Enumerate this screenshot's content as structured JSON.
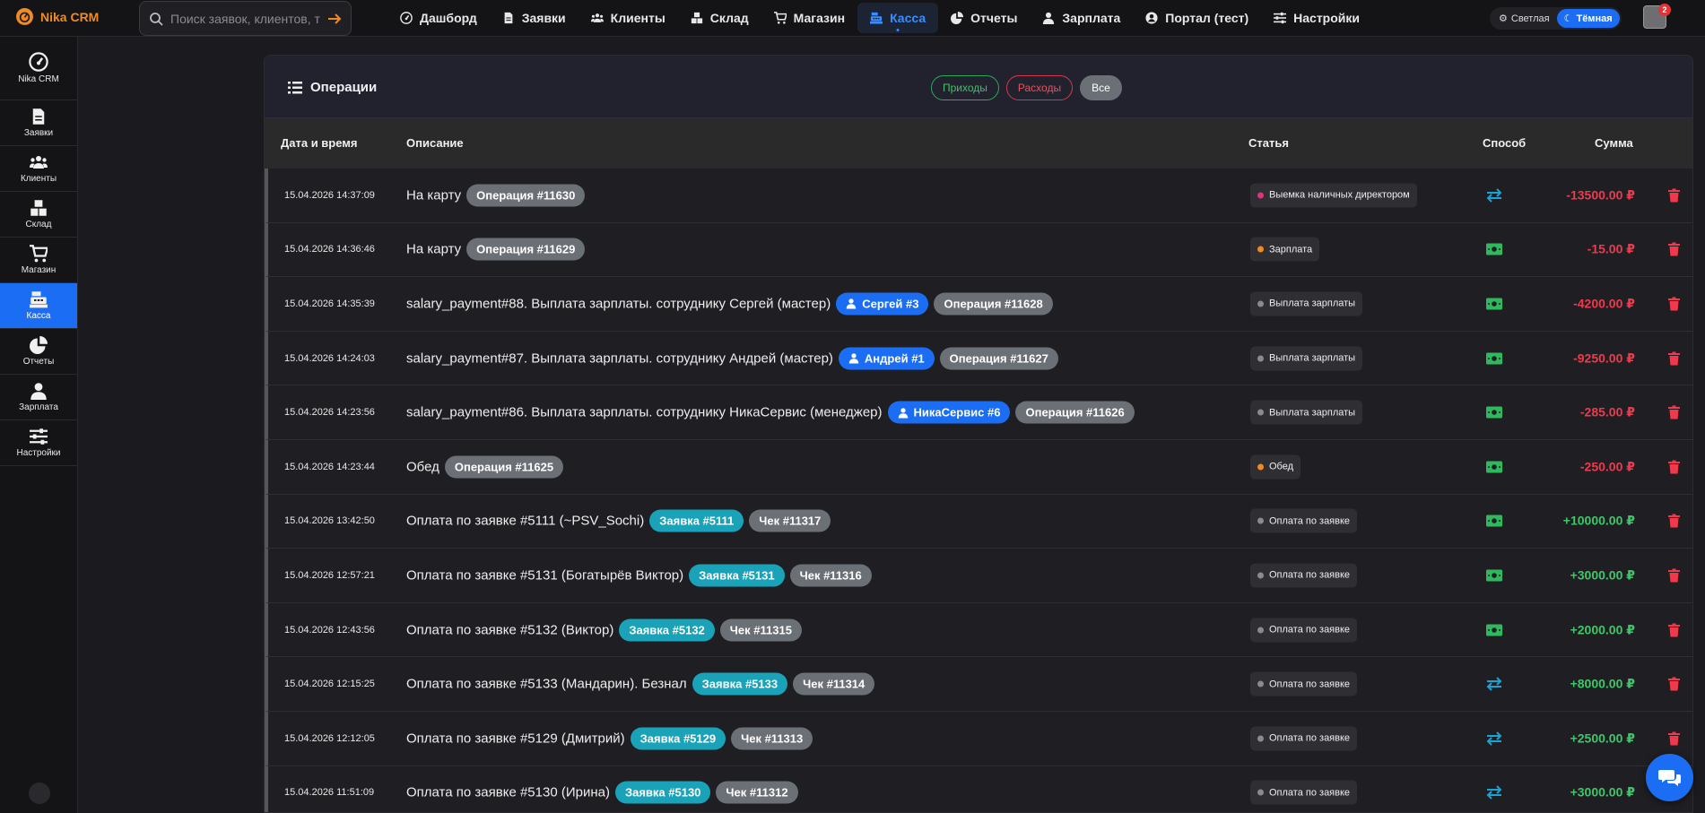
{
  "app": {
    "name": "Nika CRM"
  },
  "search": {
    "placeholder": "Поиск заявок, клиентов, т"
  },
  "nav": [
    {
      "label": "Дашборд",
      "icon": "gauge-icon"
    },
    {
      "label": "Заявки",
      "icon": "file-icon"
    },
    {
      "label": "Клиенты",
      "icon": "users-icon"
    },
    {
      "label": "Склад",
      "icon": "boxes-icon"
    },
    {
      "label": "Магазин",
      "icon": "cart-icon"
    },
    {
      "label": "Касса",
      "icon": "cash-register-icon",
      "active": true
    },
    {
      "label": "Отчеты",
      "icon": "pie-chart-icon"
    },
    {
      "label": "Зарплата",
      "icon": "user-icon"
    },
    {
      "label": "Портал (тест)",
      "icon": "user-circle-icon"
    },
    {
      "label": "Настройки",
      "icon": "sliders-icon"
    }
  ],
  "theme": {
    "light": "Светлая",
    "dark": "Тёмная"
  },
  "notifications": {
    "count": "2"
  },
  "sidebar": [
    {
      "label": "Nika CRM",
      "icon": "gauge-icon"
    },
    {
      "label": "Заявки",
      "icon": "file-icon"
    },
    {
      "label": "Клиенты",
      "icon": "users-icon"
    },
    {
      "label": "Склад",
      "icon": "boxes-icon"
    },
    {
      "label": "Магазин",
      "icon": "cart-icon"
    },
    {
      "label": "Касса",
      "icon": "cash-register-icon",
      "active": true
    },
    {
      "label": "Отчеты",
      "icon": "pie-chart-icon"
    },
    {
      "label": "Зарплата",
      "icon": "user-icon"
    },
    {
      "label": "Настройки",
      "icon": "sliders-icon"
    }
  ],
  "card": {
    "title": "Операции",
    "filters": {
      "income": "Приходы",
      "expense": "Расходы",
      "all": "Все"
    }
  },
  "table": {
    "headers": {
      "date": "Дата и время",
      "description": "Описание",
      "category": "Статья",
      "method": "Способ",
      "amount": "Сумма"
    },
    "rows": [
      {
        "date": "15.04.2026 14:37:09",
        "text": "На карту",
        "tags": [
          {
            "kind": "op",
            "label": "Операция #11630"
          }
        ],
        "category": "Выемка наличных директором",
        "cat_color": "#e0337d",
        "method": "transfer",
        "amount": "-13500.00 ₽",
        "sign": "neg"
      },
      {
        "date": "15.04.2026 14:36:46",
        "text": "На карту",
        "tags": [
          {
            "kind": "op",
            "label": "Операция #11629"
          }
        ],
        "category": "Зарплата",
        "cat_color": "#f08a24",
        "method": "cash",
        "amount": "-15.00 ₽",
        "sign": "neg"
      },
      {
        "date": "15.04.2026 14:35:39",
        "text": "salary_payment#88. Выплата зарплаты. сотруднику Сергей (мастер)",
        "tags": [
          {
            "kind": "user",
            "label": "Сергей #3"
          },
          {
            "kind": "op",
            "label": "Операция #11628"
          }
        ],
        "category": "Выплата зарплаты",
        "cat_color": "#8a8a90",
        "method": "cash",
        "amount": "-4200.00 ₽",
        "sign": "neg"
      },
      {
        "date": "15.04.2026 14:24:03",
        "text": "salary_payment#87. Выплата зарплаты. сотруднику Андрей (мастер)",
        "tags": [
          {
            "kind": "user",
            "label": "Андрей #1"
          },
          {
            "kind": "op",
            "label": "Операция #11627"
          }
        ],
        "category": "Выплата зарплаты",
        "cat_color": "#8a8a90",
        "method": "cash",
        "amount": "-9250.00 ₽",
        "sign": "neg"
      },
      {
        "date": "15.04.2026 14:23:56",
        "text": "salary_payment#86. Выплата зарплаты. сотруднику НикаСервис (менеджер)",
        "tags": [
          {
            "kind": "user",
            "label": "НикаСервис #6"
          },
          {
            "kind": "op",
            "label": "Операция #11626"
          }
        ],
        "category": "Выплата зарплаты",
        "cat_color": "#8a8a90",
        "method": "cash",
        "amount": "-285.00 ₽",
        "sign": "neg"
      },
      {
        "date": "15.04.2026 14:23:44",
        "text": "Обед",
        "tags": [
          {
            "kind": "op",
            "label": "Операция #11625"
          }
        ],
        "category": "Обед",
        "cat_color": "#f08a24",
        "method": "cash",
        "amount": "-250.00 ₽",
        "sign": "neg"
      },
      {
        "date": "15.04.2026 13:42:50",
        "text": "Оплата по заявке #5111 (~PSV_Sochi)",
        "tags": [
          {
            "kind": "order",
            "label": "Заявка #5111"
          },
          {
            "kind": "op",
            "label": "Чек #11317"
          }
        ],
        "category": "Оплата по заявке",
        "cat_color": "#8a8a90",
        "method": "cash",
        "amount": "+10000.00 ₽",
        "sign": "pos"
      },
      {
        "date": "15.04.2026 12:57:21",
        "text": "Оплата по заявке #5131 (Богатырёв Виктор)",
        "tags": [
          {
            "kind": "order",
            "label": "Заявка #5131"
          },
          {
            "kind": "op",
            "label": "Чек #11316"
          }
        ],
        "category": "Оплата по заявке",
        "cat_color": "#8a8a90",
        "method": "cash",
        "amount": "+3000.00 ₽",
        "sign": "pos"
      },
      {
        "date": "15.04.2026 12:43:56",
        "text": "Оплата по заявке #5132 (Виктор)",
        "tags": [
          {
            "kind": "order",
            "label": "Заявка #5132"
          },
          {
            "kind": "op",
            "label": "Чек #11315"
          }
        ],
        "category": "Оплата по заявке",
        "cat_color": "#8a8a90",
        "method": "cash",
        "amount": "+2000.00 ₽",
        "sign": "pos"
      },
      {
        "date": "15.04.2026 12:15:25",
        "text": "Оплата по заявке #5133 (Мандарин). Безнал",
        "tags": [
          {
            "kind": "order",
            "label": "Заявка #5133"
          },
          {
            "kind": "op",
            "label": "Чек #11314"
          }
        ],
        "category": "Оплата по заявке",
        "cat_color": "#8a8a90",
        "method": "transfer",
        "amount": "+8000.00 ₽",
        "sign": "pos"
      },
      {
        "date": "15.04.2026 12:12:05",
        "text": "Оплата по заявке #5129 (Дмитрий)",
        "tags": [
          {
            "kind": "order",
            "label": "Заявка #5129"
          },
          {
            "kind": "op",
            "label": "Чек #11313"
          }
        ],
        "category": "Оплата по заявке",
        "cat_color": "#8a8a90",
        "method": "transfer",
        "amount": "+2500.00 ₽",
        "sign": "pos"
      },
      {
        "date": "15.04.2026 11:51:09",
        "text": "Оплата по заявке #5130 (Ирина)",
        "tags": [
          {
            "kind": "order",
            "label": "Заявка #5130"
          },
          {
            "kind": "op",
            "label": "Чек #11312"
          }
        ],
        "category": "Оплата по заявке",
        "cat_color": "#8a8a90",
        "method": "transfer",
        "amount": "+3000.00 ₽",
        "sign": "pos"
      }
    ]
  },
  "colors": {
    "accent": "#1b6ef3",
    "brand": "#f08a24",
    "income": "#3ec768",
    "expense": "#f0394c",
    "order_tag": "#1aa3b8"
  }
}
